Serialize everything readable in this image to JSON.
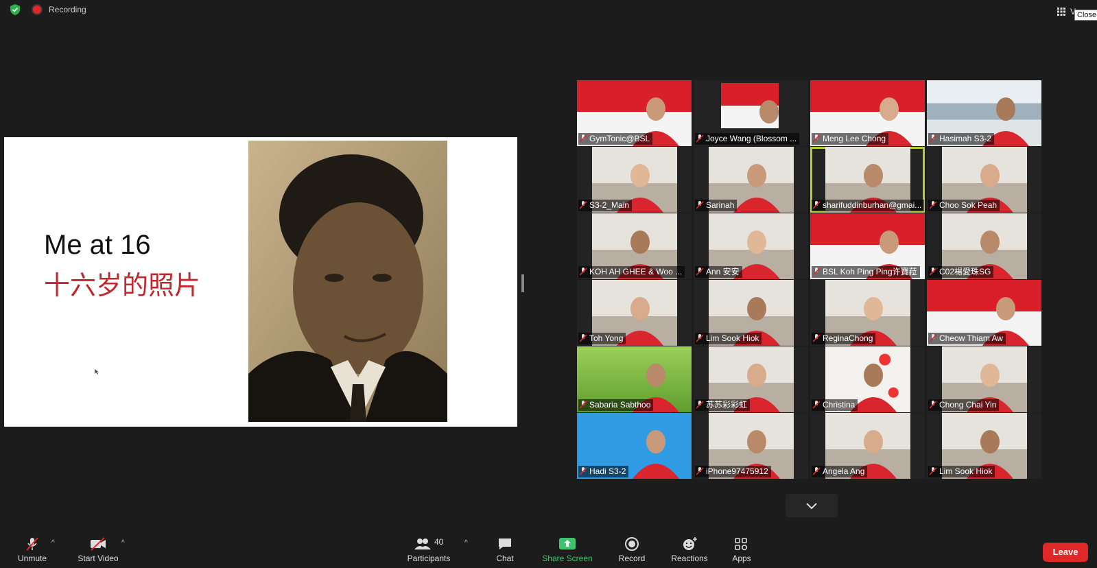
{
  "status_bar": {
    "recording_label": "Recording",
    "view_label": "V",
    "close_tooltip": "Close"
  },
  "slide": {
    "title": "Me at 16",
    "subtitle": "十六岁的照片"
  },
  "participants": [
    {
      "name": "GymTonic@BSL",
      "bg": "flag"
    },
    {
      "name": "Joyce Wang (Blossom ...",
      "bg": "flag-small"
    },
    {
      "name": "Meng Lee Chong",
      "bg": "flag"
    },
    {
      "name": "Hasimah S3-2",
      "bg": "classroom"
    },
    {
      "name": "S3-2_Main",
      "bg": "room"
    },
    {
      "name": "Sarinah",
      "bg": "room"
    },
    {
      "name": "sharifuddinburhan@gmai...",
      "bg": "room",
      "active": true
    },
    {
      "name": "Choo Sok Peah",
      "bg": "room"
    },
    {
      "name": "KOH AH GHEE & Woo ...",
      "bg": "room"
    },
    {
      "name": "Ann 安安",
      "bg": "room"
    },
    {
      "name": "BSL Koh Ping Ping许寶菈",
      "bg": "flag"
    },
    {
      "name": "C02楊愛珠SG",
      "bg": "room"
    },
    {
      "name": "Toh Yong",
      "bg": "room"
    },
    {
      "name": "Lim Sook Hiok",
      "bg": "room"
    },
    {
      "name": "ReginaChong",
      "bg": "room"
    },
    {
      "name": "Cheow Thiam Aw",
      "bg": "flag"
    },
    {
      "name": "Sabaria Sabthoo",
      "bg": "green"
    },
    {
      "name": "苏苏彩彩虹",
      "bg": "room"
    },
    {
      "name": "Christina",
      "bg": "balloons"
    },
    {
      "name": "Chong Chai Yin",
      "bg": "room"
    },
    {
      "name": "Hadi S3-2",
      "bg": "blue"
    },
    {
      "name": "iPhone97475912",
      "bg": "room"
    },
    {
      "name": "Angela Ang",
      "bg": "room"
    },
    {
      "name": "Lim Sook Hiok",
      "bg": "room"
    }
  ],
  "toolbar": {
    "unmute": "Unmute",
    "start_video": "Start Video",
    "participants": "Participants",
    "participant_count": "40",
    "chat": "Chat",
    "share_screen": "Share Screen",
    "record": "Record",
    "reactions": "Reactions",
    "apps": "Apps",
    "leave": "Leave"
  },
  "colors": {
    "accent_green": "#3ec46d",
    "leave_red": "#e02828",
    "active_speaker": "#b8c93a"
  }
}
